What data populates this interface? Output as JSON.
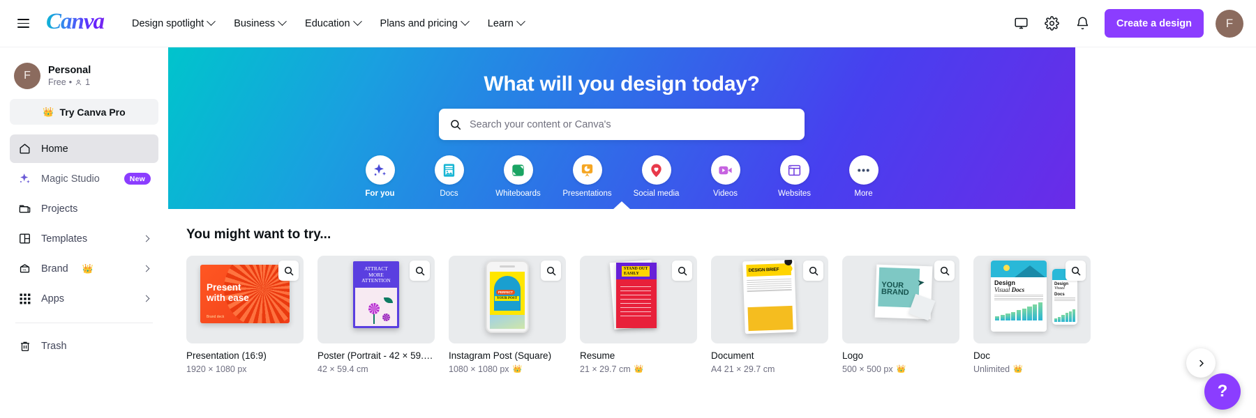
{
  "header": {
    "brand": "Canva",
    "nav": [
      {
        "label": "Design spotlight"
      },
      {
        "label": "Business"
      },
      {
        "label": "Education"
      },
      {
        "label": "Plans and pricing"
      },
      {
        "label": "Learn"
      }
    ],
    "create_button": "Create a design",
    "avatar_initial": "F"
  },
  "sidebar": {
    "avatar_initial": "F",
    "account_name": "Personal",
    "account_plan": "Free",
    "account_dot": "•",
    "account_members": "1",
    "pro_button": "Try Canva Pro",
    "items": [
      {
        "label": "Home",
        "icon": "home-icon",
        "active": true
      },
      {
        "label": "Magic Studio",
        "icon": "sparkle-icon",
        "badge": "New"
      },
      {
        "label": "Projects",
        "icon": "folder-icon"
      },
      {
        "label": "Templates",
        "icon": "templates-icon",
        "chevron": true
      },
      {
        "label": "Brand",
        "icon": "brand-icon",
        "crown": true,
        "chevron": true
      },
      {
        "label": "Apps",
        "icon": "apps-grid-icon",
        "chevron": true
      }
    ],
    "trash": {
      "label": "Trash",
      "icon": "trash-icon"
    }
  },
  "hero": {
    "title": "What will you design today?",
    "search_placeholder": "Search your content or Canva's",
    "categories": [
      {
        "label": "For you",
        "icon": "sparkle-icon",
        "color": "#4b4bd6",
        "selected": true
      },
      {
        "label": "Docs",
        "icon": "doc-icon",
        "color": "#19b6d4"
      },
      {
        "label": "Whiteboards",
        "icon": "whiteboard-icon",
        "color": "#1aa463"
      },
      {
        "label": "Presentations",
        "icon": "presentation-icon",
        "color": "#f5a623"
      },
      {
        "label": "Social media",
        "icon": "heart-pin-icon",
        "color": "#e8394a"
      },
      {
        "label": "Videos",
        "icon": "video-icon",
        "color": "#c663e0"
      },
      {
        "label": "Websites",
        "icon": "website-icon",
        "color": "#6f3ce0"
      },
      {
        "label": "More",
        "icon": "more-icon",
        "color": "#3b4a6b"
      }
    ],
    "gradient_from": "#00c4cc",
    "gradient_to": "#6a2be8"
  },
  "main": {
    "section_title": "You might want to try...",
    "cards": [
      {
        "title": "Presentation (16:9)",
        "subtitle": "1920 × 1080 px",
        "art": "presentation"
      },
      {
        "title": "Poster (Portrait - 42 × 59.4 ...",
        "subtitle": "42 × 59.4 cm",
        "art": "poster"
      },
      {
        "title": "Instagram Post (Square)",
        "subtitle": "1080 × 1080 px",
        "subtitle_icon": "crown-icon",
        "art": "instagram"
      },
      {
        "title": "Resume",
        "subtitle": "21 × 29.7 cm",
        "subtitle_icon": "crown-icon",
        "art": "resume"
      },
      {
        "title": "Document",
        "subtitle": "A4 21 × 29.7 cm",
        "art": "document"
      },
      {
        "title": "Logo",
        "subtitle": "500 × 500 px",
        "subtitle_icon": "crown-icon",
        "art": "logo"
      },
      {
        "title": "Doc",
        "subtitle": "Unlimited",
        "subtitle_icon": "crown-icon",
        "art": "doc"
      }
    ],
    "magnify_icon": "magnify-icon",
    "next_arrow": "chevron-right-icon",
    "help_label": "?"
  },
  "colors": {
    "accent_purple": "#8b3dff",
    "avatar_brown": "#8b6b5e",
    "sidebar_active": "#e4e4e8"
  }
}
